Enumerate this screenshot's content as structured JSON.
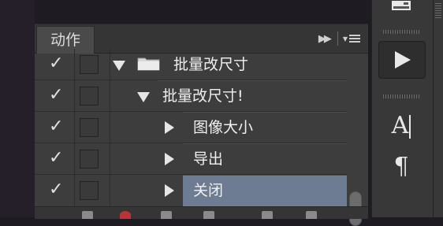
{
  "panel": {
    "tab_label": "动作",
    "rows": [
      {
        "label": "批量改尺寸",
        "level": "set",
        "expanded": true,
        "checked": true
      },
      {
        "label": "批量改尺寸!",
        "level": "action",
        "expanded": true,
        "checked": true
      },
      {
        "label": "图像大小",
        "level": "step",
        "expanded": false,
        "checked": true
      },
      {
        "label": "导出",
        "level": "step",
        "expanded": false,
        "checked": true
      },
      {
        "label": "关闭",
        "level": "step",
        "expanded": false,
        "checked": true,
        "selected": true
      }
    ],
    "check_glyph": "✓"
  },
  "tools": {
    "play_icon": "play-icon",
    "type_glyph": "A",
    "paragraph_glyph": "¶"
  },
  "colors": {
    "selected_row": "#6d7c93",
    "panel_bg": "#3d3d3d",
    "header_bg": "#353535"
  }
}
